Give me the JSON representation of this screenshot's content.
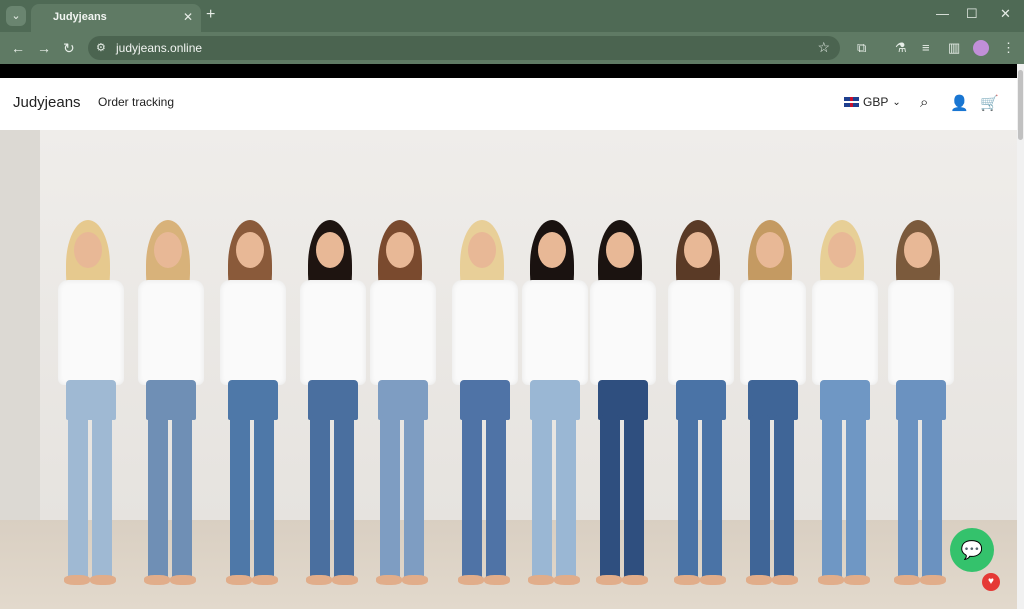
{
  "browser": {
    "tab_title": "Judyjeans",
    "url": "judyjeans.online",
    "icons": [
      "tab-menu-icon",
      "close-icon",
      "new-tab-icon",
      "minimize-icon",
      "maximize-icon",
      "close-window-icon",
      "back-icon",
      "forward-icon",
      "reload-icon",
      "site-settings-icon",
      "star-icon",
      "extensions-icon",
      "flask-icon",
      "tab-search-icon",
      "sidepanel-icon",
      "profile-icon",
      "menu-icon"
    ]
  },
  "header": {
    "brand": "Judyjeans",
    "nav_order_tracking": "Order tracking",
    "currency": "GBP"
  },
  "hero": {
    "image": "group-photo-women-in-white-shirts-and-jeans"
  }
}
